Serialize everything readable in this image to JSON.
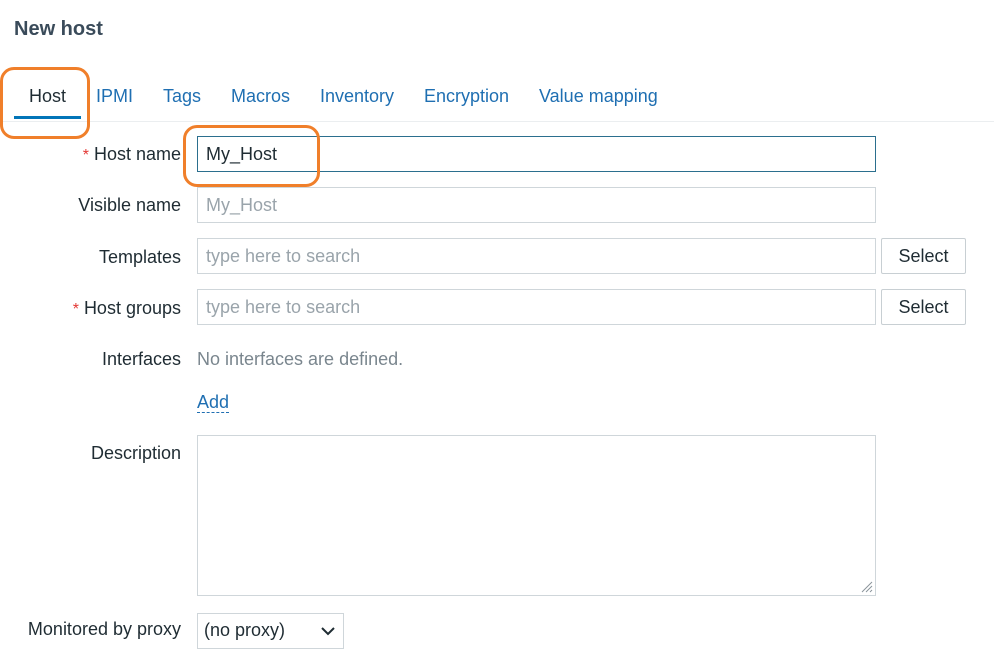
{
  "page": {
    "title": "New host"
  },
  "tabs": [
    {
      "label": "Host"
    },
    {
      "label": "IPMI"
    },
    {
      "label": "Tags"
    },
    {
      "label": "Macros"
    },
    {
      "label": "Inventory"
    },
    {
      "label": "Encryption"
    },
    {
      "label": "Value mapping"
    }
  ],
  "form": {
    "host_name": {
      "label": "Host name",
      "required": true,
      "value": "My_Host"
    },
    "visible_name": {
      "label": "Visible name",
      "placeholder": "My_Host"
    },
    "templates": {
      "label": "Templates",
      "placeholder": "type here to search",
      "select_label": "Select"
    },
    "host_groups": {
      "label": "Host groups",
      "required": true,
      "placeholder": "type here to search",
      "select_label": "Select"
    },
    "interfaces": {
      "label": "Interfaces",
      "empty_text": "No interfaces are defined.",
      "add_label": "Add"
    },
    "description": {
      "label": "Description",
      "value": ""
    },
    "proxy": {
      "label": "Monitored by proxy",
      "selected": "(no proxy)"
    },
    "required_marker": "*"
  },
  "colors": {
    "accent": "#0275b8",
    "link": "#1f6fb2",
    "required": "#e33734",
    "highlight": "#f07f2a"
  }
}
